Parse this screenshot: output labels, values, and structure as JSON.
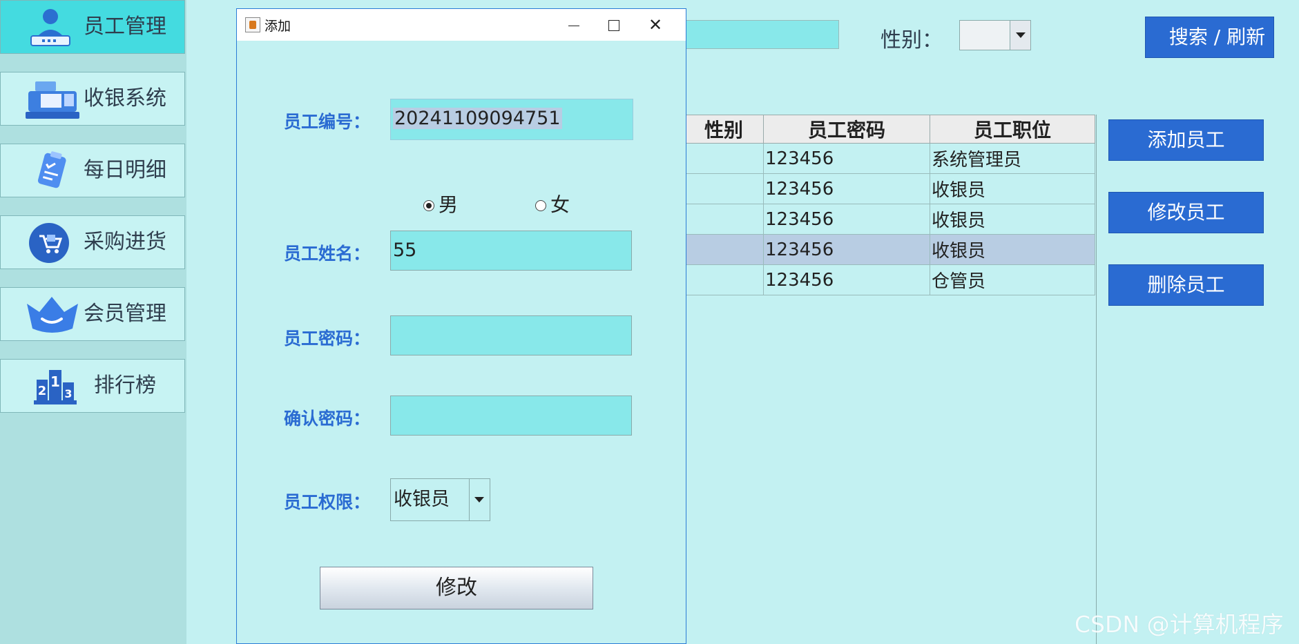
{
  "sidebar": {
    "items": [
      {
        "label": "员工管理",
        "icon": "user-badge-icon",
        "active": true
      },
      {
        "label": "收银系统",
        "icon": "cash-register-icon"
      },
      {
        "label": "每日明细",
        "icon": "clipboard-check-icon"
      },
      {
        "label": "采购进货",
        "icon": "cart-icon"
      },
      {
        "label": "会员管理",
        "icon": "crown-icon"
      },
      {
        "label": "排行榜",
        "icon": "podium-icon"
      }
    ]
  },
  "toolbar": {
    "gender_label": "性别：",
    "search_button": "搜索 / 刷新"
  },
  "actions": {
    "add": "添加员工",
    "edit": "修改员工",
    "delete": "删除员工"
  },
  "table": {
    "headers": [
      "性别",
      "员工密码",
      "员工职位"
    ],
    "rows": [
      {
        "gender": "",
        "password": "123456",
        "position": "系统管理员"
      },
      {
        "gender": "",
        "password": "123456",
        "position": "收银员"
      },
      {
        "gender": "",
        "password": "123456",
        "position": "收银员"
      },
      {
        "gender": "",
        "password": "123456",
        "position": "收银员",
        "selected": true
      },
      {
        "gender": "",
        "password": "123456",
        "position": "仓管员"
      }
    ]
  },
  "dialog": {
    "title": "添加",
    "id_label": "员工编号：",
    "id_value": "20241109094751",
    "gender_male": "男",
    "gender_female": "女",
    "name_label": "员工姓名：",
    "name_value": "55",
    "password_label": "员工密码：",
    "password_value": "",
    "confirm_label": "确认密码：",
    "confirm_value": "",
    "role_label": "员工权限：",
    "role_value": "收银员",
    "submit_button": "修改"
  },
  "colors": {
    "background": "#c3f1f2",
    "accent_blue": "#2a6bd2",
    "input_fill": "#88e8ea",
    "sidebar_active": "#44dbe0"
  },
  "watermark": "CSDN @计算机程序"
}
